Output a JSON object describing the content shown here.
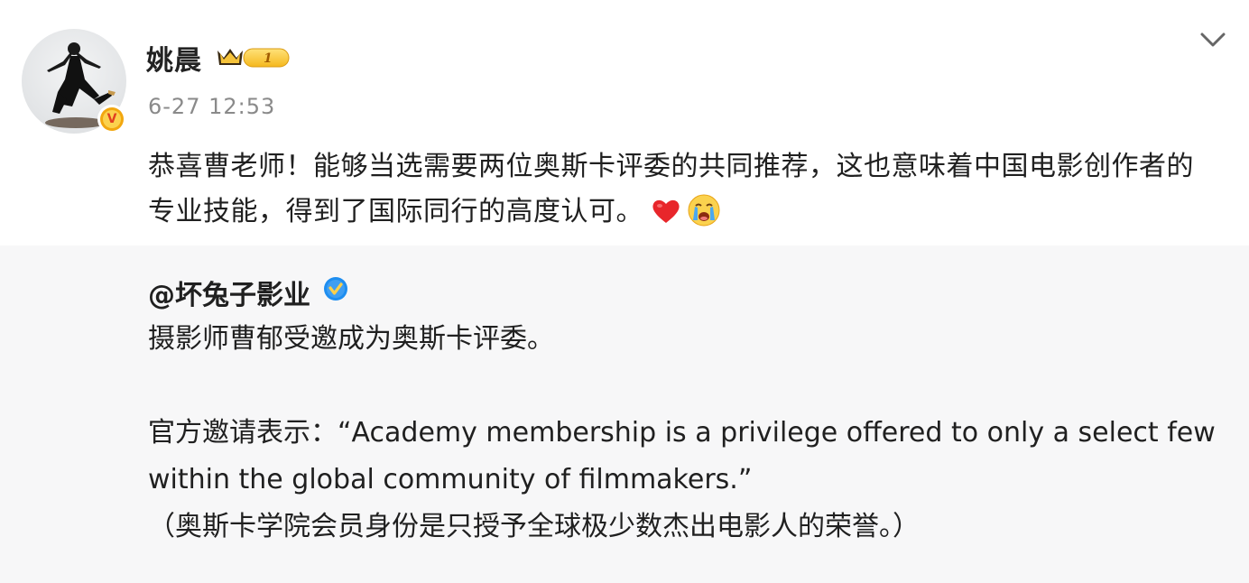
{
  "post": {
    "username": "姚晨",
    "vip_level": "1",
    "timestamp": "6-27 12:53",
    "text": "恭喜曹老师！能够当选需要两位奥斯卡评委的共同推荐，这也意味着中国电影创作者的专业技能，得到了国际同行的高度认可。",
    "emoji": [
      "heart-emoji",
      "crying-face-emoji"
    ]
  },
  "repost": {
    "author": "@坏兔子影业",
    "lines": [
      "摄影师曹郁受邀成为奥斯卡评委。",
      "",
      "官方邀请表示：“Academy membership is a privilege offered to only a select few",
      "within the global community of filmmakers.”",
      "（奥斯卡学院会员身份是只授予全球极少数杰出电影人的荣誉。）"
    ]
  },
  "colors": {
    "repost_background": "#f7f7f8",
    "timestamp": "#8a8a8a",
    "verified_blue": "#1e8ef0",
    "verified_gold": "#f2a70f"
  },
  "icons": {
    "menu": "chevron-down-icon",
    "verified": "verified-badge-icon",
    "vip": "vip-crown-icon"
  }
}
